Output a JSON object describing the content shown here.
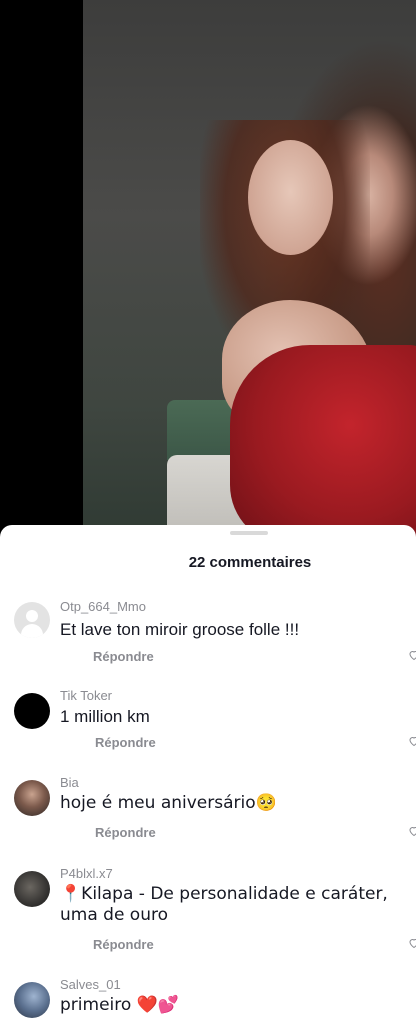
{
  "comments_panel": {
    "title": "22 commentaires",
    "reply_label": "Répondre",
    "comments": [
      {
        "username": "Otp_664_Mmo",
        "text": "Et lave ton miroir groose folle !!!"
      },
      {
        "username": "Tik Toker",
        "text": "1 million km"
      },
      {
        "username": "Bia",
        "text": "hoje é meu aniversário🥺"
      },
      {
        "username": "P4blxl.x7",
        "text": "📍Kilapa - De personalidade e caráter, uma de ouro"
      },
      {
        "username": "Salves_01",
        "text": "primeiro ❤️💕"
      }
    ]
  },
  "icons": {
    "like": "heart-outline-icon",
    "avatar_default": "default-avatar-icon"
  },
  "colors": {
    "panel_bg": "#ffffff",
    "text_primary": "#161823",
    "text_secondary": "#8a8b91",
    "video_bg": "#000000",
    "dress_red": "#c3242c"
  }
}
